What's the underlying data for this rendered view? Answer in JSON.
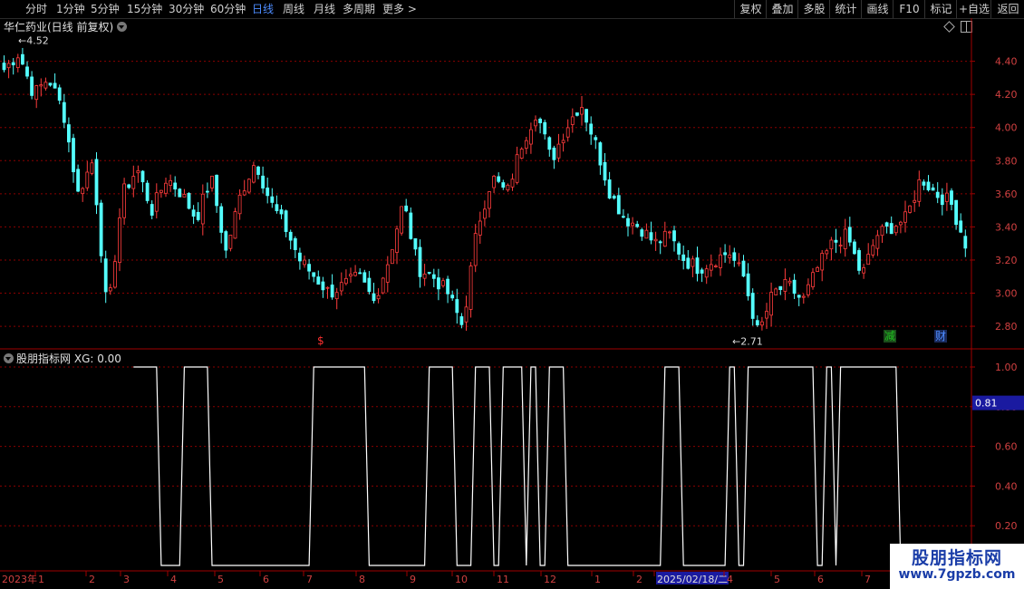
{
  "toolbar": {
    "periods": [
      "分时",
      "1分钟",
      "5分钟",
      "15分钟",
      "30分钟",
      "60分钟",
      "日线",
      "周线",
      "月线",
      "多周期",
      "更多 >"
    ],
    "active_period": "日线",
    "right_buttons": [
      "复权",
      "叠加",
      "多股",
      "统计",
      "画线",
      "F10",
      "标记",
      "+自选",
      "返回"
    ]
  },
  "main_panel": {
    "title": "华仁药业(日线 前复权)",
    "high_label": "4.52",
    "low_label": "2.71",
    "y_ticks": [
      "4.40",
      "4.20",
      "4.00",
      "3.80",
      "3.60",
      "3.40",
      "3.20",
      "3.00",
      "2.80"
    ],
    "markers": [
      {
        "text": "$",
        "color": "#ff3030"
      },
      {
        "text": "减",
        "color": "#20c020"
      },
      {
        "text": "财",
        "color": "#4d8cff"
      }
    ]
  },
  "indicator_panel": {
    "title": "股朋指标网",
    "readout": "XG: 0.00",
    "y_ticks": [
      "1.00",
      "0.80",
      "0.60",
      "0.40",
      "0.20"
    ],
    "cursor_value": "0.81"
  },
  "time_axis": {
    "labels": [
      "2023年",
      "1",
      "2",
      "3",
      "4",
      "5",
      "6",
      "7",
      "8",
      "9",
      "10",
      "11",
      "12",
      "1",
      "2",
      "2025/02/18/二",
      "4",
      "5",
      "6",
      "7"
    ]
  },
  "watermark": {
    "title": "股朋指标网",
    "url": "www.7gpzb.com"
  },
  "colors": {
    "up": "#ff3c3c",
    "down": "#54ffff",
    "grid": "#8b0000",
    "axis": "#a00000",
    "signal": "#ffffff",
    "active_tab": "#4d8cff"
  },
  "chart_data": {
    "type": "candlestick",
    "price_range": [
      2.68,
      4.54
    ],
    "anchor_closes": [
      4.35,
      4.45,
      4.2,
      4.3,
      4.1,
      3.6,
      3.8,
      2.85,
      3.6,
      3.75,
      3.5,
      3.7,
      3.6,
      3.45,
      3.7,
      3.25,
      3.6,
      3.8,
      3.55,
      3.4,
      3.2,
      3.1,
      3.0,
      3.05,
      3.1,
      2.95,
      3.2,
      3.55,
      3.15,
      3.1,
      3.0,
      2.8,
      3.4,
      3.7,
      3.6,
      3.9,
      4.1,
      3.8,
      4.0,
      4.15,
      3.9,
      3.6,
      3.45,
      3.4,
      3.3,
      3.35,
      3.2,
      3.15,
      3.2,
      3.25,
      3.1,
      2.75,
      3.0,
      3.05,
      2.95,
      3.15,
      3.3,
      3.35,
      3.1,
      3.35,
      3.4,
      3.45,
      3.7,
      3.6,
      3.55,
      3.3
    ],
    "signal_periods": [
      [
        1,
        6
      ],
      [
        10,
        12
      ],
      [
        14,
        16
      ],
      [
        27,
        33
      ],
      [
        39,
        44
      ],
      [
        67,
        78
      ],
      [
        92,
        97
      ],
      [
        102,
        105
      ],
      [
        108,
        112
      ],
      [
        114,
        115
      ],
      [
        118,
        121
      ],
      [
        143,
        146
      ],
      [
        157,
        158
      ],
      [
        161,
        175
      ],
      [
        178,
        179
      ],
      [
        181,
        193
      ]
    ]
  }
}
